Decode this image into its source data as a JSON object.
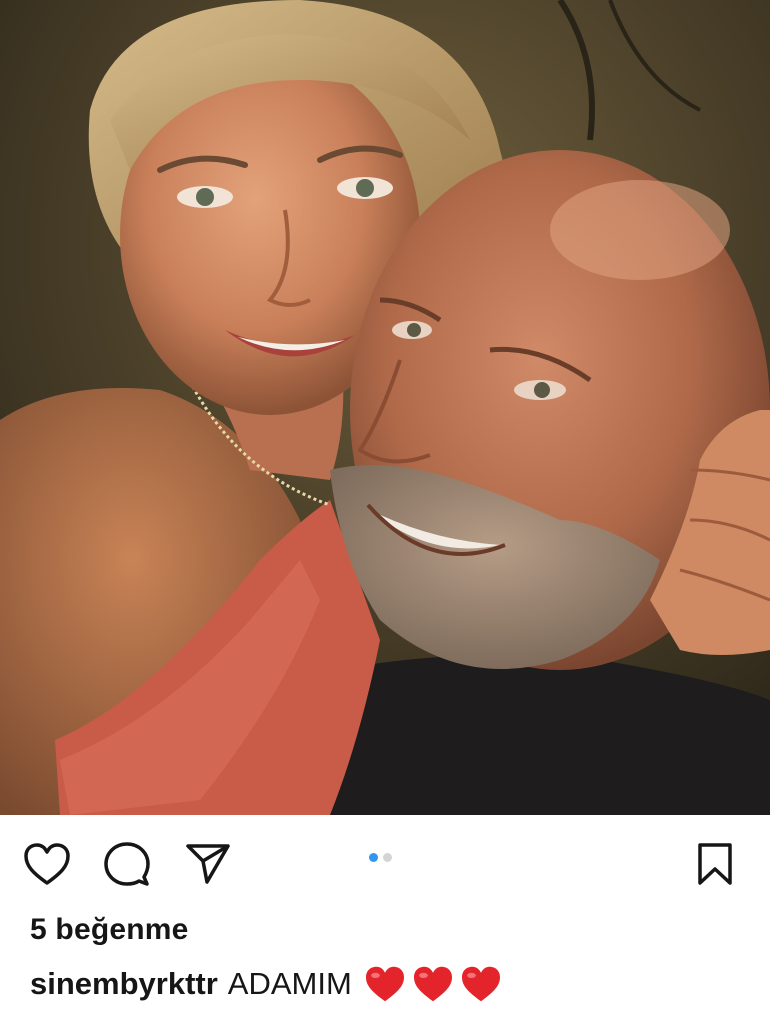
{
  "post": {
    "photo": {
      "alt": "",
      "carousel_total": 2,
      "carousel_active": 1
    },
    "actions": {
      "like_icon": "heart-outline-icon",
      "comment_icon": "comment-bubble-icon",
      "share_icon": "paper-plane-icon",
      "save_icon": "bookmark-outline-icon"
    },
    "likes_text": "5 beğenme",
    "caption": {
      "username": "sinembyrkttr",
      "text": "ADAMIM",
      "emojis": [
        "red-heart",
        "red-heart",
        "red-heart"
      ]
    },
    "colors": {
      "dot_active": "#2f97f0",
      "dot_inactive": "#d4d4d4",
      "heart_red": "#e3252b",
      "text": "#161616"
    }
  }
}
